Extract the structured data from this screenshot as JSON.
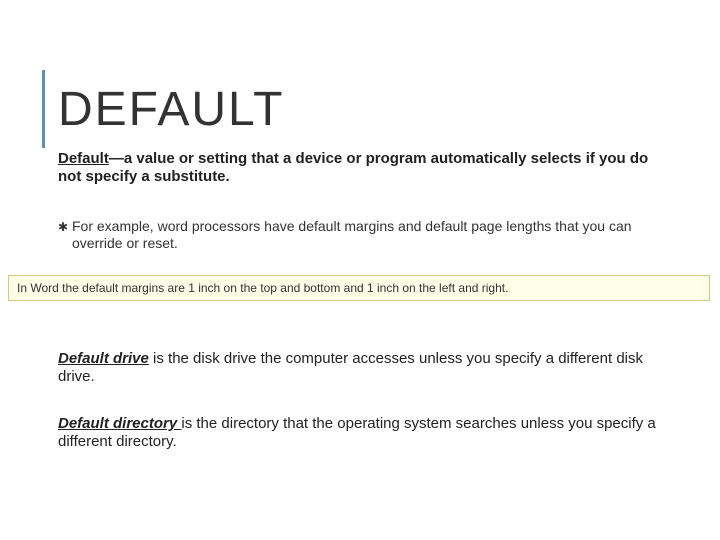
{
  "title": "DEFAULT",
  "definition": {
    "term": "Default",
    "rest_a": "—a value or setting that a device or program ",
    "strong": "automatically",
    "rest_b": " selects if you do not specify a substitute."
  },
  "bullet_icon": "✱",
  "example": "For example, word processors have default margins and default page lengths that you can override or reset.",
  "callout": "In Word the default margins are 1 inch on the top and bottom and 1 inch on the left and right.",
  "para1": {
    "term": "Default drive",
    "rest": " is the disk drive the computer accesses unless you specify a different disk drive."
  },
  "para2": {
    "term": "Default directory ",
    "rest": " is the directory that the operating system searches unless you specify a different directory."
  }
}
